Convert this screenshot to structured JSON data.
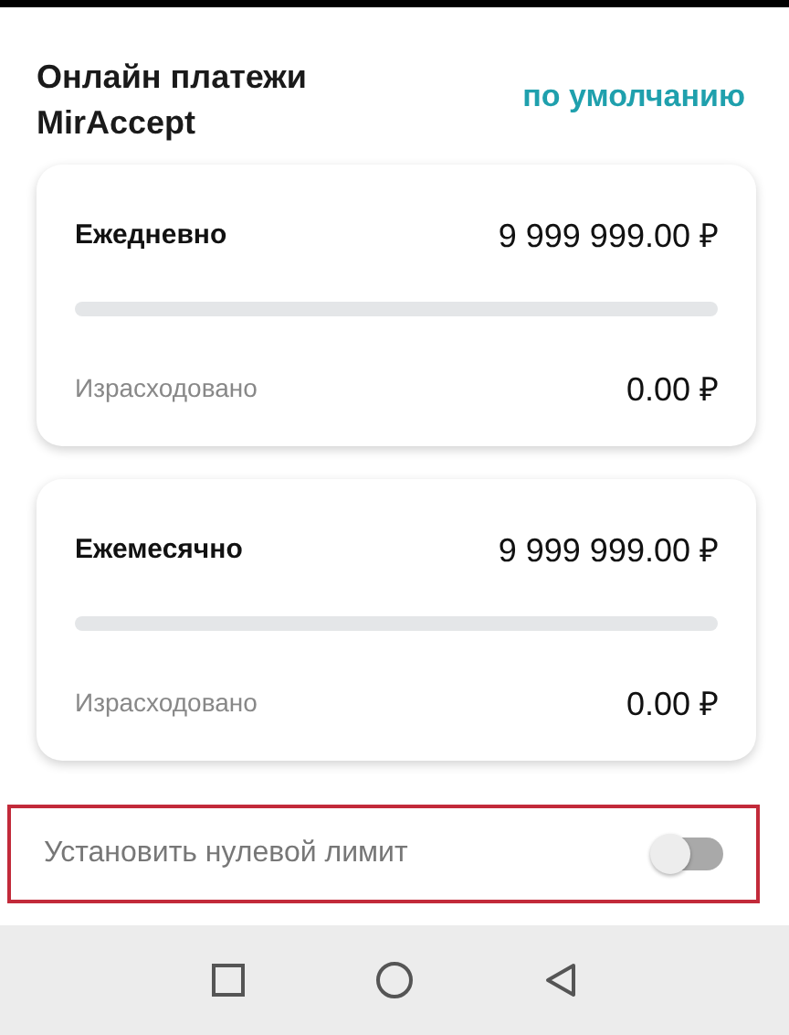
{
  "header": {
    "title": "Онлайн платежи MirAccept",
    "badge": "по умолчанию"
  },
  "limits": [
    {
      "period": "Ежедневно",
      "limit": "9 999 999.00 ₽",
      "level": 0,
      "spent_label": "Израсходовано",
      "spent": "0.00 ₽"
    },
    {
      "period": "Ежемесячно",
      "limit": "9 999 999.00 ₽",
      "level": 0,
      "spent_label": "Израсходовано",
      "spent": "0.00 ₽"
    }
  ],
  "zero_limit": {
    "label": "Установить нулевой лимит",
    "on": false,
    "highlighted": true
  }
}
